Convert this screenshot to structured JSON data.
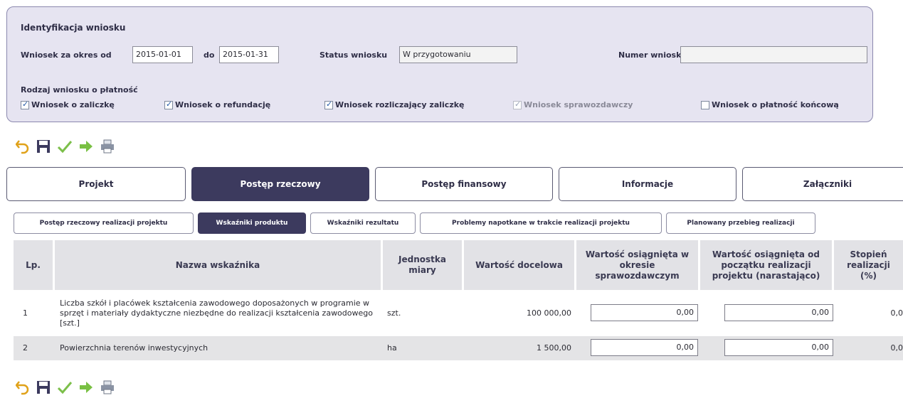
{
  "identification": {
    "title": "Identyfikacja wniosku",
    "period_from_label": "Wniosek za okres od",
    "period_from": "2015-01-01",
    "period_to_label": "do",
    "period_to": "2015-01-31",
    "status_label": "Status wniosku",
    "status_value": "W przygotowaniu",
    "number_label": "Numer wniosku",
    "number_value": "",
    "type_label": "Rodzaj wniosku o płatność",
    "types": [
      {
        "label": "Wniosek o zaliczkę",
        "checked": true,
        "enabled": true
      },
      {
        "label": "Wniosek o refundację",
        "checked": true,
        "enabled": true
      },
      {
        "label": "Wniosek rozliczający zaliczkę",
        "checked": true,
        "enabled": true
      },
      {
        "label": "Wniosek sprawozdawczy",
        "checked": true,
        "enabled": false
      },
      {
        "label": "Wniosek o płatność końcową",
        "checked": false,
        "enabled": true
      }
    ]
  },
  "toolbar_icons": [
    "undo-icon",
    "save-icon",
    "check-icon",
    "send-icon",
    "print-icon"
  ],
  "tabs": [
    "Projekt",
    "Postęp rzeczowy",
    "Postęp finansowy",
    "Informacje",
    "Załączniki"
  ],
  "active_tab": 1,
  "subtabs": [
    "Postęp rzeczowy realizacji projektu",
    "Wskaźniki produktu",
    "Wskaźniki rezultatu",
    "Problemy napotkane w trakcie realizacji projektu",
    "Planowany przebieg realizacji"
  ],
  "active_subtab": 1,
  "table": {
    "headers": [
      "Lp.",
      "Nazwa wskaźnika",
      "Jednostka miary",
      "Wartość docelowa",
      "Wartość osiągnięta w okresie sprawozdawczym",
      "Wartość osiągnięta od początku realizacji projektu (narastająco)",
      "Stopień realizacji (%)"
    ],
    "rows": [
      {
        "lp": "1",
        "name": "Liczba szkół i placówek kształcenia zawodowego doposażonych w programie w sprzęt i materiały dydaktyczne niezbędne do realizacji kształcenia zawodowego [szt.]",
        "unit": "szt.",
        "target": "100 000,00",
        "period_value": "0,00",
        "cumulative_value": "0,00",
        "degree": "0,0"
      },
      {
        "lp": "2",
        "name": "Powierzchnia terenów inwestycyjnych",
        "unit": "ha",
        "target": "1 500,00",
        "period_value": "0,00",
        "cumulative_value": "0,00",
        "degree": "0,0"
      }
    ]
  },
  "colors": {
    "accent": "#3c3a5e",
    "panel": "#e6e4f1",
    "header": "#e2e2e6"
  }
}
